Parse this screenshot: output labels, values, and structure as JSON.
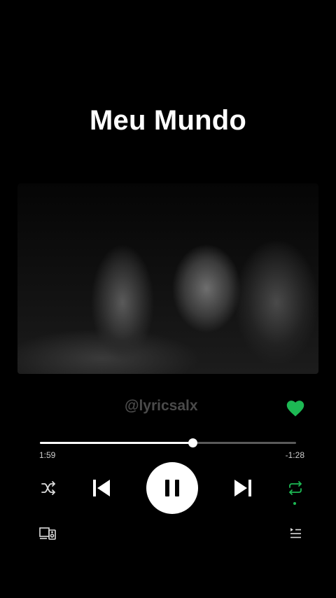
{
  "track": {
    "title": "Meu Mundo"
  },
  "overlay": {
    "handle": "@lyricsalx"
  },
  "progress": {
    "elapsed": "1:59",
    "remaining": "-1:28",
    "fraction": 0.595
  },
  "colors": {
    "accent": "#1db954",
    "background": "#000000",
    "foreground": "#ffffff"
  },
  "icons": {
    "like": "heart-icon",
    "shuffle": "shuffle-icon",
    "previous": "skip-previous-icon",
    "play_pause": "pause-icon",
    "next": "skip-next-icon",
    "repeat": "repeat-icon",
    "devices": "devices-icon",
    "queue": "queue-icon"
  },
  "state": {
    "liked": true,
    "playing": true,
    "repeat_on": true
  }
}
